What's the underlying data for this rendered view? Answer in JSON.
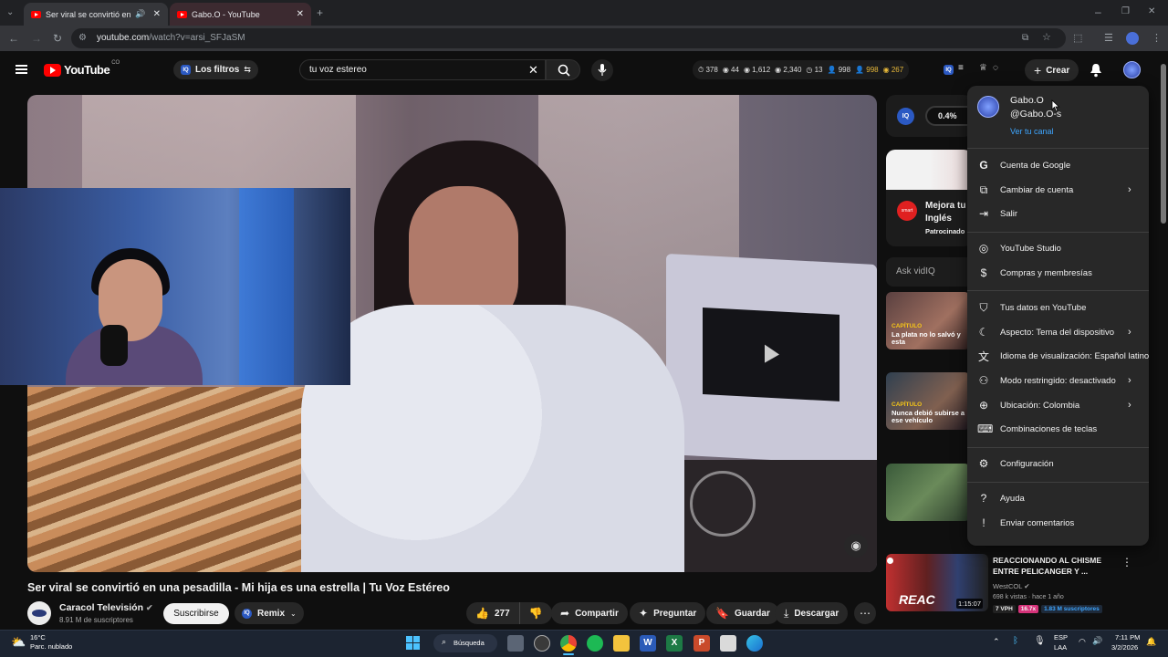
{
  "browser": {
    "tabs": [
      {
        "title": "Ser viral se convirtió en una",
        "active": true
      },
      {
        "title": "Gabo.O - YouTube",
        "active": false
      }
    ],
    "url_host": "youtube.com",
    "url_path": "/watch?v=arsi_SFJaSM"
  },
  "header": {
    "logo_text": "YouTube",
    "logo_region": "CO",
    "filter_label": "Los filtros",
    "search_value": "tu voz estereo",
    "stats": [
      "378",
      "44",
      "1,612",
      "2,340",
      "13",
      "998",
      "998",
      "267"
    ],
    "create_label": "Crear"
  },
  "video": {
    "title": "Ser viral se convirtió en una pesadilla - Mi hija es una estrella | Tu Voz Estéreo",
    "channel_name": "Caracol Televisión",
    "subscribers": "8.91 M de suscriptores",
    "subscribe_label": "Suscribirse",
    "remix_label": "Remix",
    "likes": "277",
    "share_label": "Compartir",
    "ask_label": "Preguntar",
    "save_label": "Guardar",
    "download_label": "Descargar"
  },
  "sidebar": {
    "iq_percent": "0.4%",
    "ad_title_line1": "Mejora tu",
    "ad_title_line2": "Inglés",
    "ad_sponsored": "Patrocinado",
    "ask_placeholder": "Ask vidIQ",
    "thumb1_tag": "CAPÍTULO",
    "thumb1_title": "La plata no lo salvó y esta",
    "thumb2_tag": "CAPÍTULO",
    "thumb2_title": "Nunca debió subirse a ese vehículo",
    "bottom_title": "REACCIONANDO AL CHISME ENTRE PELICANGER Y ...",
    "bottom_channel": "WestCOL",
    "bottom_meta": "698 k vistas · hace 1 año",
    "bottom_vph": "7 VPH",
    "bottom_score": "16.7x",
    "bottom_subs": "1.83 M suscriptores",
    "bottom_duration": "1:15:07",
    "bottom_thumb_text": "REAC"
  },
  "account_menu": {
    "name": "Gabo.O",
    "handle": "@Gabo.O-s",
    "view_channel": "Ver tu canal",
    "items": [
      {
        "label": "Cuenta de Google",
        "icon": "google-icon",
        "chevron": false
      },
      {
        "label": "Cambiar de cuenta",
        "icon": "switch-account-icon",
        "chevron": true
      },
      {
        "label": "Salir",
        "icon": "sign-out-icon",
        "chevron": false
      },
      {
        "label": "YouTube Studio",
        "icon": "studio-icon",
        "chevron": false
      },
      {
        "label": "Compras y membresías",
        "icon": "dollar-icon",
        "chevron": false
      },
      {
        "label": "Tus datos en YouTube",
        "icon": "shield-icon",
        "chevron": false
      },
      {
        "label": "Aspecto: Tema del dispositivo",
        "icon": "moon-icon",
        "chevron": true
      },
      {
        "label": "Idioma de visualización: Español latinoamérica",
        "icon": "translate-icon",
        "chevron": false
      },
      {
        "label": "Modo restringido: desactivado",
        "icon": "restricted-icon",
        "chevron": true
      },
      {
        "label": "Ubicación: Colombia",
        "icon": "globe-icon",
        "chevron": true
      },
      {
        "label": "Combinaciones de teclas",
        "icon": "keyboard-icon",
        "chevron": false
      },
      {
        "label": "Configuración",
        "icon": "gear-icon",
        "chevron": false
      },
      {
        "label": "Ayuda",
        "icon": "help-icon",
        "chevron": false
      },
      {
        "label": "Enviar comentarios",
        "icon": "feedback-icon",
        "chevron": false
      }
    ]
  },
  "taskbar": {
    "temp": "16°C",
    "weather": "Parc. nublado",
    "search_label": "Búsqueda",
    "lang1": "ESP",
    "lang2": "LAA",
    "time": "7:11 PM",
    "date": "3/2/2026"
  },
  "colors": {
    "yt_red": "#ff0000",
    "menu_bg": "#282828",
    "link_blue": "#3ea6ff",
    "vidiq_blue": "#2b59c3"
  }
}
